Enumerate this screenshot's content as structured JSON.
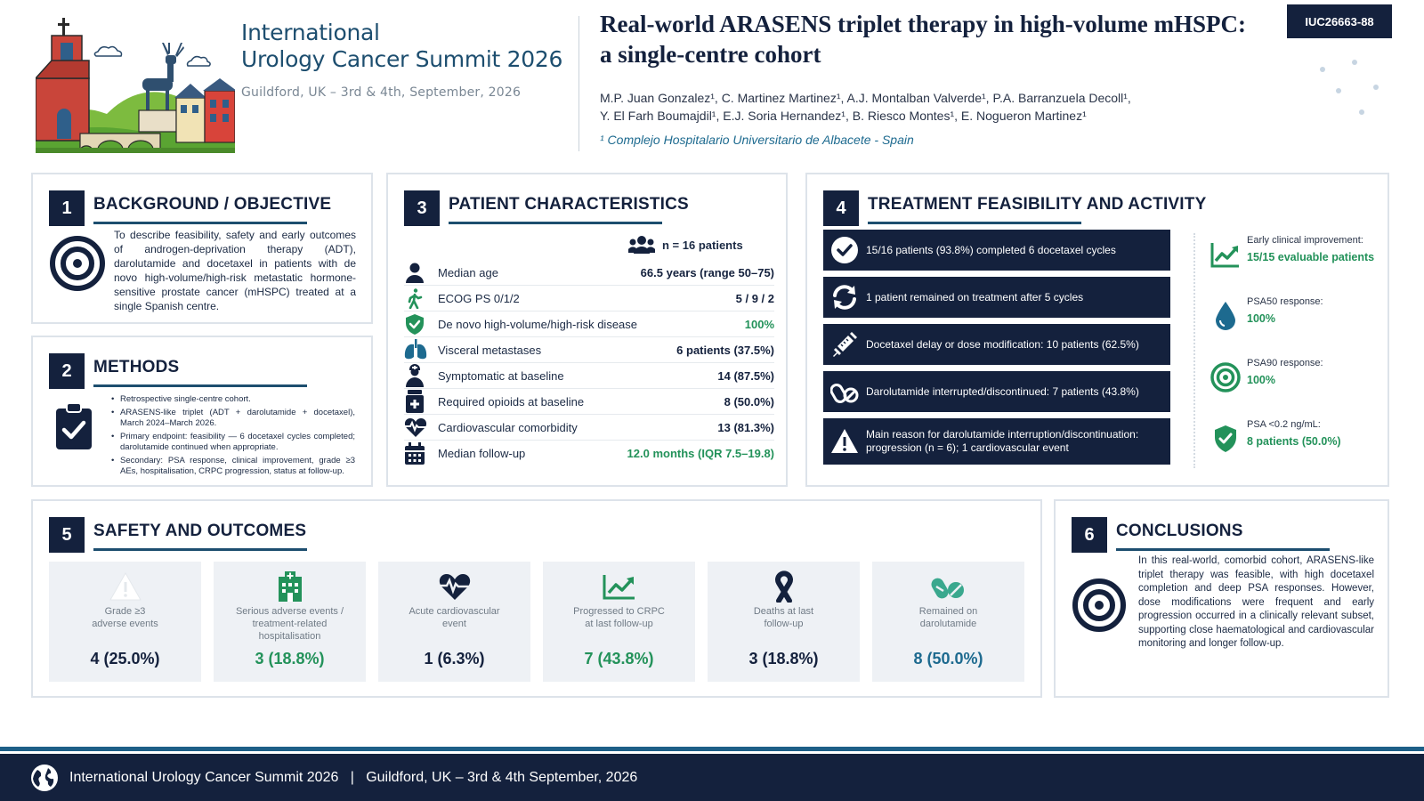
{
  "conference": {
    "title_line1": "International",
    "title_line2": "Urology Cancer Summit 2026",
    "subtitle": "Guildford, UK – 3rd & 4th, September, 2026"
  },
  "poster": {
    "title_line1": "Real-world ARASENS triplet therapy in high-volume mHSPC:",
    "title_line2": "a single-centre cohort",
    "authors_line1": "M.P. Juan Gonzalez¹, C. Martinez Martinez¹, A.J. Montalban Valverde¹, P.A. Barranzuela Decoll¹,",
    "authors_line2": "Y. El Farh Boumajdil¹, E.J. Soria Hernandez¹, B. Riesco Montes¹, E. Nogueron Martinez¹",
    "affiliation": "¹ Complejo Hospitalario Universitario de Albacete - Spain",
    "id": "IUC26663-88"
  },
  "sections": {
    "s1": {
      "num": "1",
      "title": "BACKGROUND / OBJECTIVE",
      "text": "To describe feasibility, safety and early outcomes of androgen-deprivation therapy (ADT), darolutamide and docetaxel in patients with de novo high-volume/high-risk metastatic hormone-sensitive prostate cancer (mHSPC) treated at a single Spanish centre."
    },
    "s2": {
      "num": "2",
      "title": "METHODS",
      "items": [
        "Retrospective single-centre cohort.",
        "ARASENS-like triplet (ADT + darolutamide + docetaxel), March 2024–March 2026.",
        "Primary endpoint: feasibility — 6 docetaxel cycles completed; darolutamide continued when appropriate.",
        "Secondary: PSA response, clinical improvement, grade ≥3 AEs, hospitalisation, CRPC progression, status at follow-up."
      ]
    },
    "s3": {
      "num": "3",
      "title": "PATIENT CHARACTERISTICS",
      "n_label": "n = 16 patients",
      "rows": [
        {
          "icon": "person-icon",
          "label": "Median age",
          "value": "66.5 years (range 50–75)"
        },
        {
          "icon": "walking-icon",
          "label": "ECOG PS 0/1/2",
          "value": "5 / 9 / 2"
        },
        {
          "icon": "shield-check-icon",
          "label": "De novo high-volume/high-risk disease",
          "value": "100%"
        },
        {
          "icon": "lungs-icon",
          "label": "Visceral metastases",
          "value": "6 patients (37.5%)"
        },
        {
          "icon": "patient-icon",
          "label": "Symptomatic at baseline",
          "value": "14 (87.5%)"
        },
        {
          "icon": "medicine-bottle-icon",
          "label": "Required opioids at baseline",
          "value": "8 (50.0%)"
        },
        {
          "icon": "heart-pulse-icon",
          "label": "Cardiovascular comorbidity",
          "value": "13 (81.3%)"
        },
        {
          "icon": "calendar-icon",
          "label": "Median follow-up",
          "value": "12.0 months (IQR 7.5–19.8)"
        }
      ]
    },
    "s4": {
      "num": "4",
      "title": "TREATMENT FEASIBILITY AND ACTIVITY",
      "bars": [
        {
          "icon": "check-circle-icon",
          "text": "15/16 patients (93.8%) completed 6 docetaxel cycles"
        },
        {
          "icon": "refresh-icon",
          "text": "1 patient remained on treatment after 5 cycles"
        },
        {
          "icon": "syringe-icon",
          "text": "Docetaxel delay or dose modification: 10 patients (62.5%)"
        },
        {
          "icon": "pills-icon",
          "text": "Darolutamide interrupted/discontinued: 7 patients (43.8%)"
        },
        {
          "icon": "warning-icon",
          "text": "Main reason for darolutamide interruption/discontinuation: progression (n = 6); 1 cardiovascular event"
        }
      ],
      "activity": [
        {
          "icon": "trend-chart-icon",
          "label": "Early clinical improvement:",
          "value": "15/15 evaluable patients"
        },
        {
          "icon": "drop-icon",
          "label": "PSA50 response:",
          "value": "100%"
        },
        {
          "icon": "target-icon",
          "label": "PSA90 response:",
          "value": "100%"
        },
        {
          "icon": "shield-check-icon",
          "label": "PSA <0.2 ng/mL:",
          "value": "8 patients (50.0%)"
        }
      ]
    },
    "s5": {
      "num": "5",
      "title": "SAFETY AND OUTCOMES",
      "tiles": [
        {
          "icon": "warning-icon",
          "label": "Grade ≥3\nadverse events",
          "value": "4 (25.0%)"
        },
        {
          "icon": "hospital-icon",
          "label": "Serious adverse events /\ntreatment-related\nhospitalisation",
          "value": "3 (18.8%)"
        },
        {
          "icon": "heart-pulse-icon",
          "label": "Acute cardiovascular\nevent",
          "value": "1 (6.3%)"
        },
        {
          "icon": "trend-chart-icon",
          "label": "Progressed to CRPC\nat last follow-up",
          "value": "7 (43.8%)"
        },
        {
          "icon": "ribbon-icon",
          "label": "Deaths at last\nfollow-up",
          "value": "3 (18.8%)"
        },
        {
          "icon": "pills-icon",
          "label": "Remained on\ndarolutamide",
          "value": "8 (50.0%)"
        }
      ]
    },
    "s6": {
      "num": "6",
      "title": "CONCLUSIONS",
      "text": "In this real-world, comorbid cohort, ARASENS-like triplet therapy was feasible, with high docetaxel completion and deep PSA responses. However, dose modifications were frequent and early progression occurred in a clinically relevant subset, supporting close haematological and cardiovascular monitoring and longer follow-up."
    }
  },
  "footer": {
    "text": "International Urology Cancer Summit 2026   |   Guildford, UK – 3rd & 4th September, 2026"
  },
  "colors": {
    "navy": "#14213d",
    "green": "#23925a",
    "teal": "#1d6a8f",
    "tile_bg": "#eef1f5"
  }
}
